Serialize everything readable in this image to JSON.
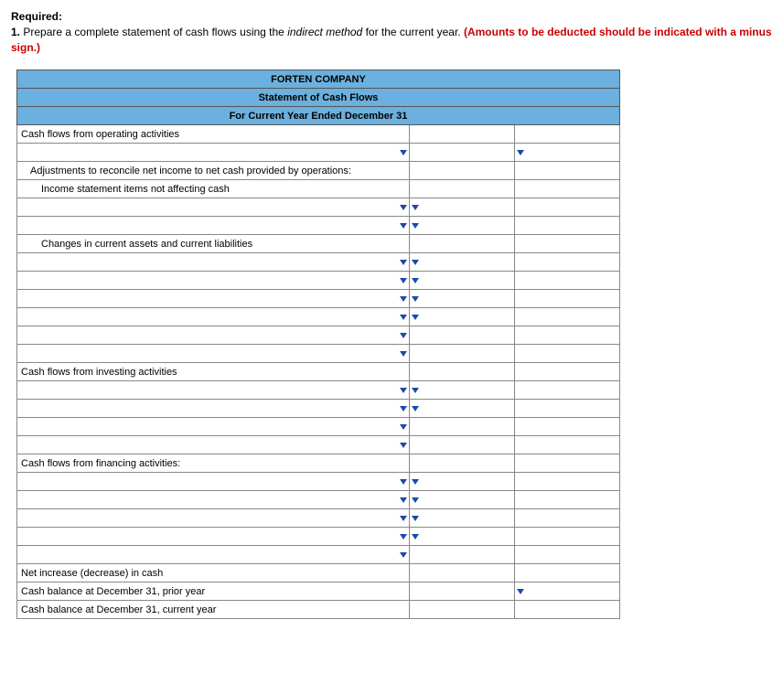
{
  "question": {
    "required_label": "Required:",
    "number": "1.",
    "text_before_italic": "Prepare a complete statement of cash flows using the ",
    "italic_text": "indirect method",
    "text_after_italic": " for the current year. ",
    "red_text": "(Amounts to be deducted should be indicated with a minus sign.)"
  },
  "table": {
    "title1": "FORTEN COMPANY",
    "title2": "Statement of Cash Flows",
    "title3": "For Current Year Ended December 31",
    "operating_section": "Cash flows from operating activities",
    "adjustments": "Adjustments to reconcile net income to net cash provided by operations:",
    "nonaffecting": "Income statement items not affecting cash",
    "changes": "Changes in current assets and current liabilities",
    "investing_section": "Cash flows from investing activities",
    "financing_section": "Cash flows from financing activities:",
    "net_change": "Net increase (decrease) in cash",
    "prior_balance": "Cash balance at December 31, prior year",
    "current_balance": "Cash balance at December 31, current year"
  }
}
